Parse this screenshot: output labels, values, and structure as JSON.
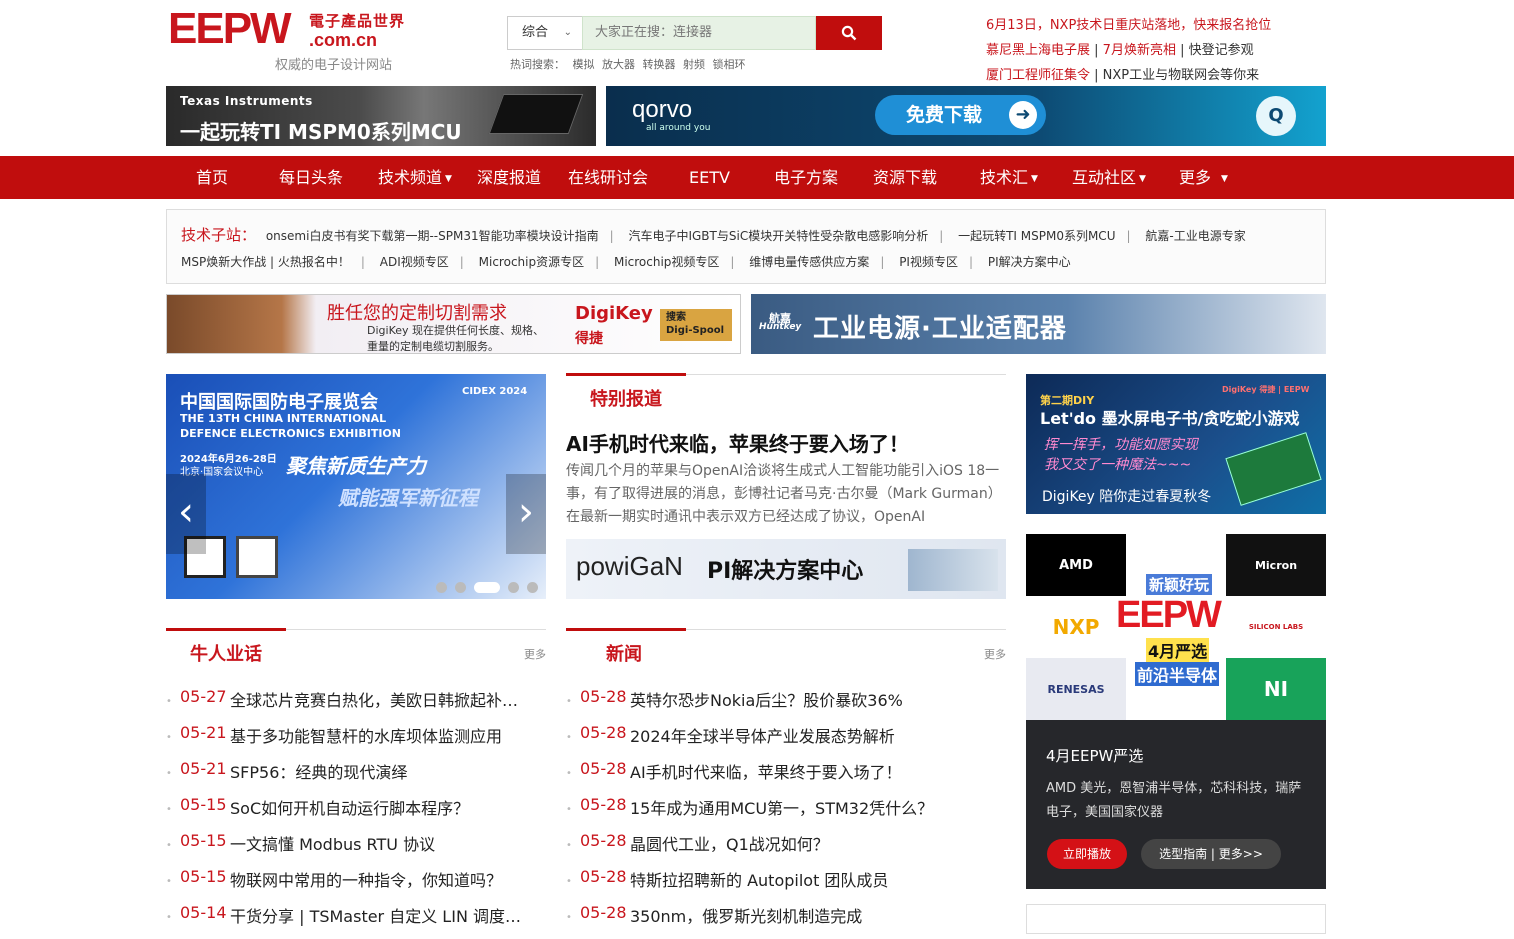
{
  "header": {
    "logo": "EEPW",
    "logo_cn": "電子產品世界",
    "logo_domain": ".com.cn",
    "slogan": "权威的电子设计网站",
    "search": {
      "category": "综合",
      "placeholder": "大家正在搜：连接器"
    },
    "hot_label": "热词搜索：",
    "hot_words": [
      "模拟",
      "放大器",
      "转换器",
      "射频",
      "锁相环"
    ],
    "right_news": [
      {
        "red": "6月13日，NXP技术日重庆站落地，快来报名抢位",
        "gray": ""
      },
      {
        "red": "慕尼黑上海电子展",
        "gray": " | ",
        "red2": "7月焕新亮相",
        "gray2": " | 快登记参观"
      },
      {
        "red": "厦门工程师征集令",
        "gray": " | NXP工业与物联网会等你来"
      }
    ]
  },
  "ads": {
    "ti": {
      "brand": "Texas Instruments",
      "text": "一起玩转TI MSPM0系列MCU"
    },
    "qorvo": {
      "brand": "qorvo",
      "sub": "all around you",
      "button": "免费下载"
    },
    "digikey": {
      "headline": "胜任您的定制切割需求",
      "body1": "DigiKey 现在提供任何长度、规格、",
      "body2": "重量的定制电缆切割服务。",
      "brand": "DigiKey",
      "brand_cn": "得捷",
      "search_label": "搜索",
      "search_term": "Digi-Spool"
    },
    "hunkey": {
      "brand": "航嘉",
      "brand_en": "Huntkey",
      "text": "工业电源·工业适配器"
    },
    "powigan": {
      "brand": "powiGaN",
      "text": "PI解决方案中心"
    },
    "diy": {
      "issue": "第二期DIY",
      "title": "Let'do 墨水屏电子书/贪吃蛇小游戏",
      "line1": "挥一挥手，功能如愿实现",
      "line2": "我又交了一种魔法~~~",
      "bottom": "DigiKey 陪你走过春夏秋冬",
      "corner": "DigiKey 得捷 | EEPW"
    }
  },
  "nav": [
    {
      "label": "首页",
      "dropdown": false
    },
    {
      "label": "每日头条",
      "dropdown": false
    },
    {
      "label": "技术频道",
      "dropdown": true
    },
    {
      "label": "深度报道",
      "dropdown": false
    },
    {
      "label": "在线研讨会",
      "dropdown": false
    },
    {
      "label": "EETV",
      "dropdown": false
    },
    {
      "label": "电子方案",
      "dropdown": false
    },
    {
      "label": "资源下载",
      "dropdown": false
    },
    {
      "label": "技术汇",
      "dropdown": true
    },
    {
      "label": "互动社区",
      "dropdown": true
    },
    {
      "label": "更多",
      "dropdown": true
    }
  ],
  "tech_sites": {
    "label": "技术子站：",
    "row1": [
      "onsemi白皮书有奖下载第一期--SPM31智能功率模块设计指南",
      "汽车电子中IGBT与SiC模块开关特性受杂散电感影响分析",
      "一起玩转TI MSPM0系列MCU",
      "航嘉-工业电源专家"
    ],
    "row2": [
      "MSP焕新大作战 | 火热报名中！",
      "ADI视频专区",
      "Microchip资源专区",
      "Microchip视频专区",
      "维博电量传感供应方案",
      "PI视频专区",
      "PI解决方案中心"
    ]
  },
  "carousel": {
    "title_cn": "中国国际国防电子展览会",
    "title_en1": "THE 13TH CHINA INTERNATIONAL",
    "title_en2": "DEFENCE ELECTRONICS EXHIBITION",
    "date": "2024年6月26-28日",
    "venue": "北京·国家会议中心",
    "slogan1": "聚焦新质生产力",
    "slogan2": "赋能强军新征程",
    "logo": "CIDEX 2024",
    "dots": 5,
    "active_dot": 3
  },
  "special": {
    "heading": "特别报道",
    "title": "AI手机时代来临，苹果终于要入场了！",
    "summary": "传闻几个月的苹果与OpenAI洽谈将生成式人工智能功能引入iOS 18一事，有了取得进展的消息，彭博社记者马克·古尔曼（Mark Gurman）在最新一期实时通讯中表示双方已经达成了协议，OpenAI"
  },
  "video": {
    "brands": [
      "AMD",
      "Micron",
      "NXP",
      "SILICON LABS",
      "RENESAS",
      "NI"
    ],
    "overlay_top": "新颖好玩",
    "overlay_logo": "EEPW",
    "overlay_mid": "4月严选",
    "overlay_bottom": "前沿半导体",
    "title": "4月EEPW严选",
    "desc": "AMD  美光，恩智浦半导体，芯科科技，瑞萨电子，美国国家仪器",
    "play": "立即播放",
    "guide": "选型指南 | 更多>>"
  },
  "niuren": {
    "heading": "牛人业话",
    "more": "更多",
    "items": [
      {
        "date": "05-27",
        "title": "全球芯片竞赛白热化，美欧日韩掀起补贴..."
      },
      {
        "date": "05-21",
        "title": "基于多功能智慧杆的水库坝体监测应用"
      },
      {
        "date": "05-21",
        "title": "SFP56：经典的现代演绎"
      },
      {
        "date": "05-15",
        "title": "SoC如何开机自动运行脚本程序？"
      },
      {
        "date": "05-15",
        "title": "一文搞懂 Modbus RTU 协议"
      },
      {
        "date": "05-15",
        "title": "物联网中常用的一种指令，你知道吗？"
      },
      {
        "date": "05-14",
        "title": "干货分享 | TSMaster 自定义 LIN 调度表..."
      }
    ]
  },
  "news": {
    "heading": "新闻",
    "more": "更多",
    "items": [
      {
        "date": "05-28",
        "title": "英特尔恐步Nokia后尘？股价暴砍36%"
      },
      {
        "date": "05-28",
        "title": "2024年全球半导体产业发展态势解析"
      },
      {
        "date": "05-28",
        "title": "AI手机时代来临，苹果终于要入场了！"
      },
      {
        "date": "05-28",
        "title": "15年成为通用MCU第一，STM32凭什么？"
      },
      {
        "date": "05-28",
        "title": "晶圆代工业，Q1战况如何？"
      },
      {
        "date": "05-28",
        "title": "特斯拉招聘新的 Autopilot 团队成员"
      },
      {
        "date": "05-28",
        "title": "350nm，俄罗斯光刻机制造完成"
      }
    ]
  },
  "colors": {
    "brand_red": "#c00d0d",
    "text_red": "#c8161d"
  }
}
